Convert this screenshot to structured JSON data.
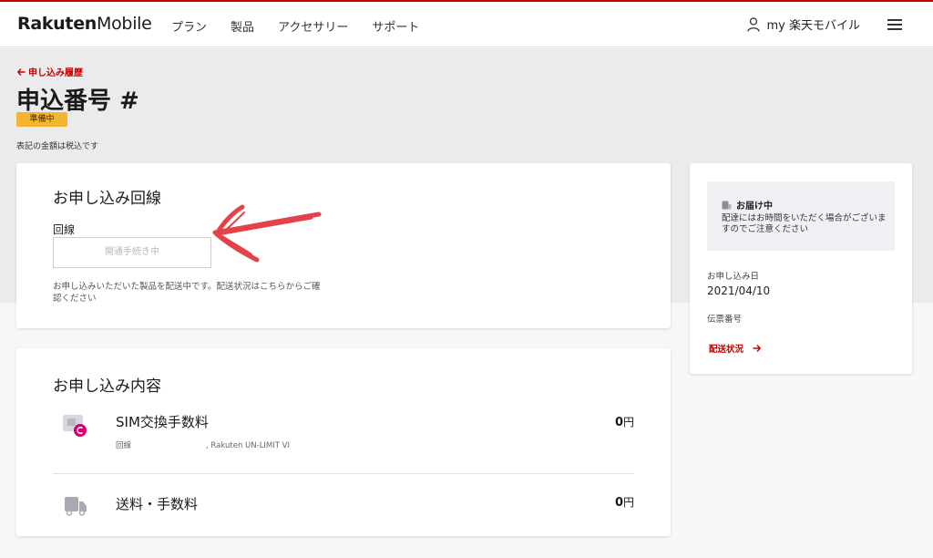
{
  "header": {
    "logo_bold": "Rakuten",
    "logo_light": "Mobile",
    "nav": [
      "プラン",
      "製品",
      "アクセサリー",
      "サポート"
    ],
    "account_label": "my 楽天モバイル"
  },
  "page": {
    "back_link": "申し込み履歴",
    "title": "申込番号 #",
    "status_badge": "準備中",
    "tax_note": "表記の金額は税込です"
  },
  "line_card": {
    "heading": "お申し込み回線",
    "field_label": "回線",
    "field_value": "開通手続き中",
    "note": "お申し込みいただいた製品を配送中です。配送状況はこちらからご確認ください"
  },
  "order_card": {
    "heading": "お申し込み内容",
    "items": [
      {
        "name": "SIM交換手数料",
        "sub_prefix": "回線",
        "sub_suffix": ", Rakuten UN-LIMIT VI",
        "price_value": "0",
        "price_unit": "円"
      },
      {
        "name": "送料・手数料",
        "price_value": "0",
        "price_unit": "円"
      }
    ]
  },
  "delivery_card": {
    "status_title": "お届け中",
    "status_desc": "配達にはお時間をいただく場合がございますのでご注意ください",
    "order_date_label": "お申し込み日",
    "order_date": "2021/04/10",
    "tracking_label": "伝票番号",
    "tracking_link": "配送状況"
  },
  "colors": {
    "brand": "#bf0000",
    "badge": "#f6b52e",
    "icon_magenta": "#d0006f"
  },
  "icons": [
    "user-icon",
    "hamburger-icon",
    "arrow-left-icon",
    "sim-icon",
    "truck-icon",
    "package-icon",
    "arrow-right-icon"
  ]
}
